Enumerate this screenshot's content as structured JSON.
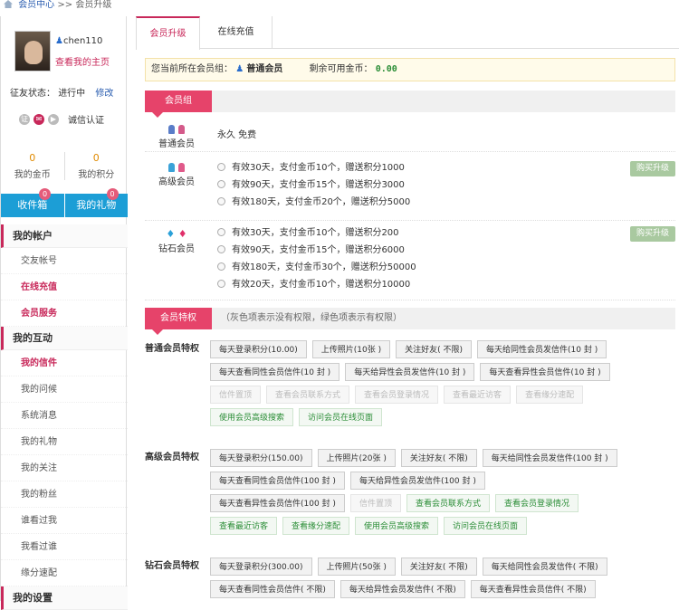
{
  "breadcrumb": {
    "home": "会员中心",
    "sep": ">>",
    "current": "会员升级"
  },
  "user": {
    "name": "chen110",
    "home_link": "查看我的主页",
    "status_label": "征友状态：",
    "status_value": "进行中",
    "edit": "修改",
    "verify_label": "诚信认证"
  },
  "stats": [
    {
      "value": "0",
      "label": "我的金币"
    },
    {
      "value": "0",
      "label": "我的积分"
    }
  ],
  "inbox": {
    "inbox_label": "收件箱",
    "inbox_badge": "0",
    "gift_label": "我的礼物",
    "gift_badge": "0"
  },
  "menu": {
    "account": "我的帐户",
    "account_items": [
      "交友帐号",
      "在线充值",
      "会员服务"
    ],
    "interact": "我的互动",
    "interact_items": [
      "我的信件",
      "我的问候",
      "系统消息",
      "我的礼物",
      "我的关注",
      "我的粉丝",
      "谁看过我",
      "我看过谁",
      "缘分速配"
    ],
    "settings": "我的设置"
  },
  "tabs": [
    "会员升级",
    "在线充值"
  ],
  "info": {
    "prefix": "您当前所在会员组：",
    "group": "普通会员",
    "coins_label": "剩余可用金币：",
    "coins": "0.00"
  },
  "group_header": "会员组",
  "groups": {
    "normal": {
      "name": "普通会员",
      "desc": "永久 免费"
    },
    "senior": {
      "name": "高级会员",
      "options": [
        "有效30天，支付金币10个，赠送积分1000",
        "有效90天，支付金币15个，赠送积分3000",
        "有效180天，支付金币20个，赠送积分5000"
      ],
      "buy": "购买升级"
    },
    "diamond": {
      "name": "钻石会员",
      "options": [
        "有效30天，支付金币10个，赠送积分200",
        "有效90天，支付金币15个，赠送积分6000",
        "有效180天，支付金币30个，赠送积分50000",
        "有效20天，支付金币10个，赠送积分10000"
      ],
      "buy": "购买升级"
    }
  },
  "privilege_header": "会员特权",
  "privilege_note": "（灰色项表示没有权限，绿色项表示有权限）",
  "privileges": {
    "normal": {
      "title": "普通会员特权",
      "rows": [
        [
          "每天登录积分(10.00)",
          "上传照片(10张 )",
          "关注好友( 不限)",
          "每天给同性会员发信件(10 封 )"
        ],
        [
          "每天查看同性会员信件(10 封 )",
          "每天给异性会员发信件(10 封 )",
          "每天查看异性会员信件(10 封 )"
        ],
        [
          "信件置顶",
          "查看会员联系方式",
          "查看会员登录情况",
          "查看最近访客",
          "查看缘分速配"
        ],
        [
          "使用会员高级搜索",
          "访问会员在线页面"
        ]
      ]
    },
    "senior": {
      "title": "高级会员特权",
      "rows": [
        [
          "每天登录积分(150.00)",
          "上传照片(20张 )",
          "关注好友( 不限)",
          "每天给同性会员发信件(100 封 )"
        ],
        [
          "每天查看同性会员信件(100 封 )",
          "每天给异性会员发信件(100 封 )"
        ],
        [
          "每天查看异性会员信件(100 封 )",
          "信件置顶",
          "查看会员联系方式",
          "查看会员登录情况"
        ],
        [
          "查看最近访客",
          "查看缘分速配",
          "使用会员高级搜索",
          "访问会员在线页面"
        ]
      ]
    },
    "diamond": {
      "title": "钻石会员特权",
      "rows": [
        [
          "每天登录积分(300.00)",
          "上传照片(50张 )",
          "关注好友( 不限)",
          "每天给同性会员发信件( 不限)"
        ],
        [
          "每天查看同性会员信件( 不限)",
          "每天给异性会员发信件( 不限)",
          "每天查看异性会员信件( 不限)"
        ]
      ]
    }
  }
}
